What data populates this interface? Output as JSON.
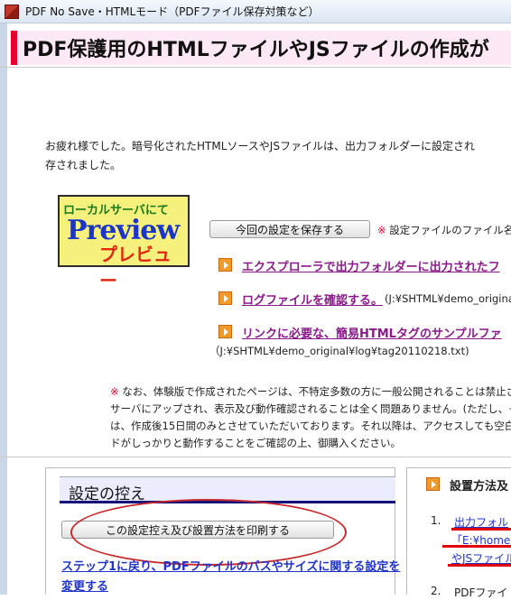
{
  "window": {
    "title": "PDF No Save・HTMLモード（PDFファイル保存対策など）"
  },
  "header": {
    "title": "PDF保護用のHTMLファイルやJSファイルの作成が"
  },
  "message": {
    "line1": "お疲れ様でした。暗号化されたHTMLソースやJSファイルは、出力フォルダーに設定され",
    "line2": "存されました。"
  },
  "preview_badge": {
    "top": "ローカルサーバにて",
    "mid": "Preview",
    "bottom": "プレビュー"
  },
  "save_button": {
    "label": "今回の設定を保存する",
    "note_mark": "※",
    "note_text": "設定ファイルのファイル名"
  },
  "links": [
    {
      "label": "エクスプローラで出力フォルダーに出力されたフ",
      "path": ""
    },
    {
      "label": "ログファイルを確認する。",
      "path": "(J:¥SHTML¥demo_origina"
    },
    {
      "label": "リンクに必要な、簡易HTMLタグのサンプルファ",
      "path": "（J:¥SHTML¥demo_original¥log¥tag20110218.txt)"
    }
  ],
  "notice": {
    "mark": "※",
    "line1": "なお、体験版で作成されたページは、不特定多数の方に一般公開されることは禁止さ",
    "line2": "サーバにアップされ、表示及び動作確認されることは全く問題ありません。(ただし、その",
    "line3": "は、作成後15日間のみとさせていただいております。それ以降は、アクセスしても空白の",
    "line4": "ドがしっかりと動作することをご確認の上、御購入ください。"
  },
  "settings": {
    "heading": "設定の控え",
    "print_button": "この設定控え及び設置方法を印刷する",
    "step_link": "ステップ1に戻り、PDFファイルのパスやサイズに関する設定を変更する"
  },
  "install": {
    "heading": "設置方法及",
    "item1_num": "1.",
    "item1_line1": "出力フォル",
    "item1_line2": "「E:¥homepa",
    "item1_line3": "やJSファイル",
    "item2_num": "2.",
    "item2_line1": "PDFファイ"
  },
  "colors": {
    "accent_red": "#e6002d",
    "header_bg": "#fde8f5",
    "link_purple": "#8a1a8a",
    "link_blue": "#2134c8",
    "arrow_orange": "#f19a27"
  }
}
